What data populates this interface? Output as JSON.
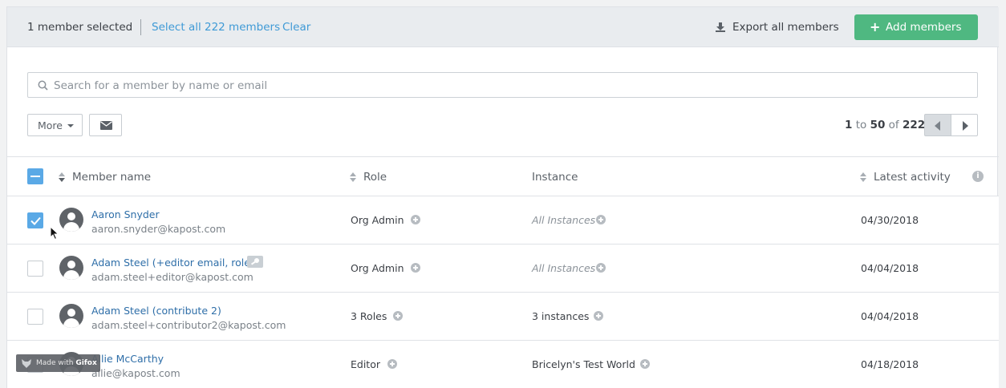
{
  "selection_bar": {
    "count_text": "1 member selected",
    "select_all_text": "Select all 222 members",
    "clear_text": "Clear",
    "export_text": "Export all members",
    "add_text": "Add members"
  },
  "search": {
    "placeholder": "Search for a member by name or email",
    "value": ""
  },
  "toolbar": {
    "more_label": "More"
  },
  "pagination": {
    "start": "1",
    "to_word": "to",
    "end": "50",
    "of_word": "of",
    "total": "222"
  },
  "table": {
    "headers": {
      "member_name": "Member name",
      "role": "Role",
      "instance": "Instance",
      "latest_activity": "Latest activity"
    },
    "rows": [
      {
        "name": "Aaron Snyder",
        "email": "aaron.snyder@kapost.com",
        "role": "Org Admin",
        "instance": "All Instances",
        "date": "04/30/2018",
        "checked": true
      },
      {
        "name": "Adam Steel (+editor email, role)",
        "email": "adam.steel+editor@kapost.com",
        "role": "Org Admin",
        "instance": "All Instances",
        "date": "04/04/2018",
        "checked": false
      },
      {
        "name": "Adam Steel (contribute 2)",
        "email": "adam.steel+contributor2@kapost.com",
        "role": "3 Roles",
        "instance": "3 instances",
        "date": "04/04/2018",
        "checked": false
      },
      {
        "name": "Allie McCarthy",
        "email": "allie@kapost.com",
        "role": "Editor",
        "instance": "Bricelyn's Test World",
        "date": "04/18/2018",
        "checked": false
      }
    ]
  },
  "watermark": {
    "made_with": "Made with",
    "brand": "Gifox"
  },
  "colors": {
    "accent_blue": "#3f9ad6",
    "add_button_green": "#4fb881",
    "checkbox_blue": "#5aa9e6",
    "link_name": "#2e6ea8"
  },
  "icons": [
    "download-icon",
    "plus-icon",
    "search-icon",
    "caret-down-icon",
    "envelope-icon",
    "chevron-left-icon",
    "chevron-right-icon",
    "sort-icon",
    "info-icon",
    "checkmark-icon",
    "avatar-icon",
    "key-icon",
    "plus-circle-icon",
    "gifox-logo-icon",
    "mouse-cursor-icon"
  ]
}
